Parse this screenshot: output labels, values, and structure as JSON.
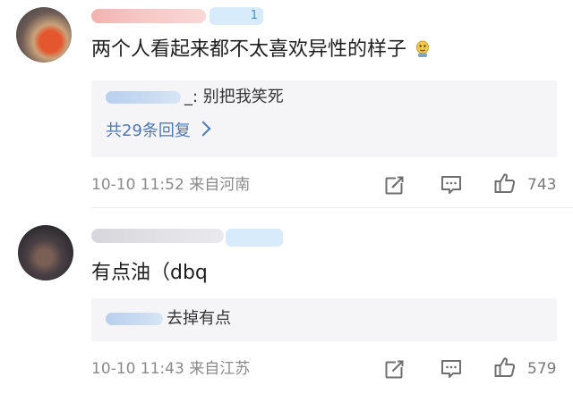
{
  "comments": [
    {
      "badge": "1",
      "text": "两个人看起来都不太喜欢异性的样子",
      "reply": {
        "text": "_: 别把我笑死",
        "view_more": "共29条回复"
      },
      "time": "10-10 11:52",
      "location": "来自河南",
      "likes": "743"
    },
    {
      "badge": "",
      "text": "有点油（dbq",
      "reply": {
        "text": "去掉有点"
      },
      "time": "10-10 11:43",
      "location": "来自江苏",
      "likes": "579"
    }
  ],
  "icons": {
    "share": "share-icon",
    "comment": "comment-icon",
    "like": "thumbs-up-icon",
    "chevron": "chevron-right-icon",
    "emoji": "emoji-icon"
  },
  "colors": {
    "link_blue": "#4b79b7",
    "reply_bg": "#f5f5f7",
    "meta_gray": "#8a8a8a"
  }
}
